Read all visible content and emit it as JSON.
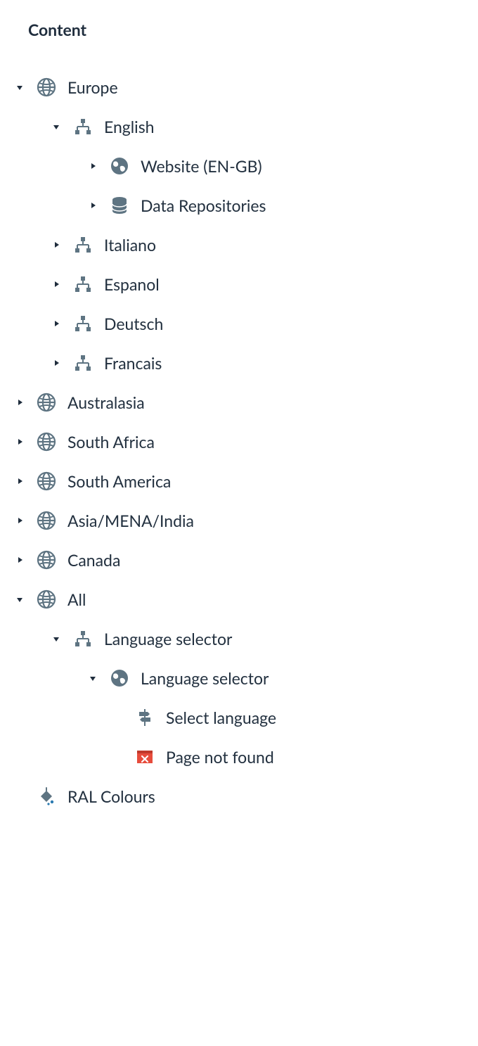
{
  "header": {
    "title": "Content"
  },
  "tree": {
    "europe": {
      "label": "Europe"
    },
    "english": {
      "label": "English"
    },
    "website_engb": {
      "label": "Website (EN-GB)"
    },
    "data_repositories": {
      "label": "Data Repositories"
    },
    "italiano": {
      "label": "Italiano"
    },
    "espanol": {
      "label": "Espanol"
    },
    "deutsch": {
      "label": "Deutsch"
    },
    "francais": {
      "label": "Francais"
    },
    "australasia": {
      "label": "Australasia"
    },
    "south_africa": {
      "label": "South Africa"
    },
    "south_america": {
      "label": "South America"
    },
    "asia_mena_india": {
      "label": "Asia/MENA/India"
    },
    "canada": {
      "label": "Canada"
    },
    "all": {
      "label": "All"
    },
    "lang_selector_1": {
      "label": "Language selector"
    },
    "lang_selector_2": {
      "label": "Language selector"
    },
    "select_language": {
      "label": "Select language"
    },
    "page_not_found": {
      "label": "Page not found"
    },
    "ral_colours": {
      "label": "RAL Colours"
    }
  },
  "icons": {
    "caret_color": "#1f2d3d",
    "node_color": "#5e7482",
    "error_color": "#e74c3c"
  }
}
